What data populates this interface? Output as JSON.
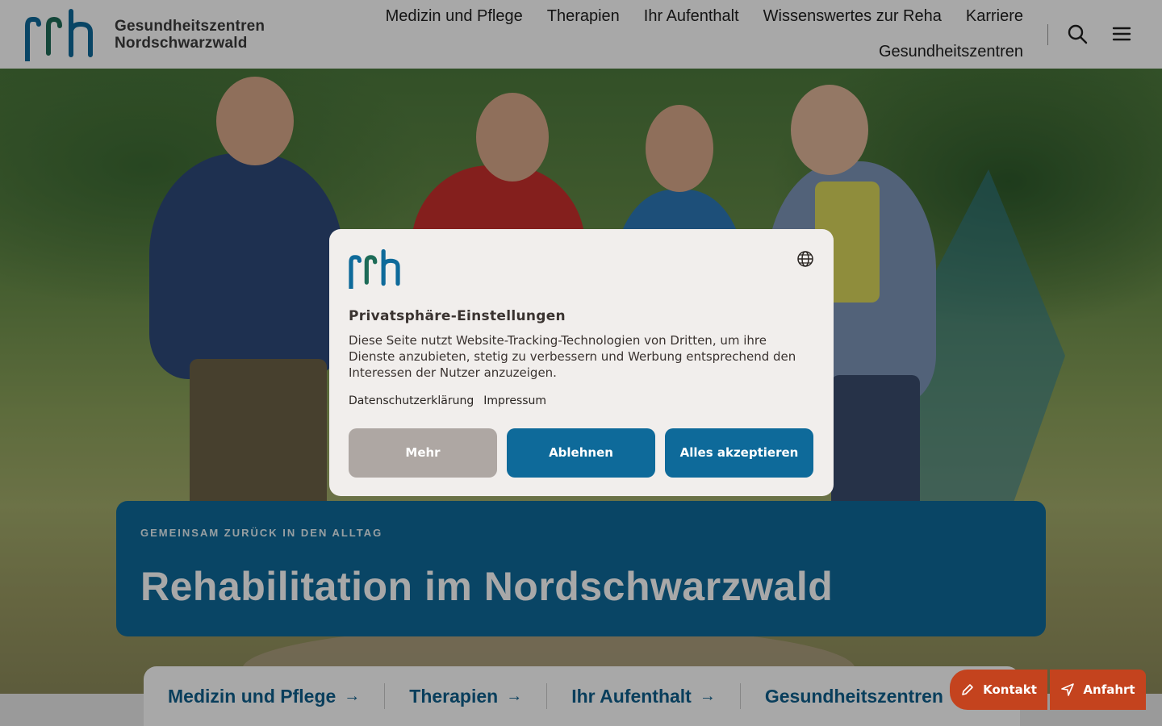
{
  "header": {
    "logo_letters": "srh",
    "logo_line1": "Gesundheitszentren",
    "logo_line2": "Nordschwarzwald",
    "nav": [
      "Medizin und Pflege",
      "Therapien",
      "Ihr Aufenthalt",
      "Wissenswertes zur Reha",
      "Karriere",
      "Gesundheitszentren"
    ],
    "icons": [
      "search-icon",
      "menu-icon"
    ]
  },
  "hero": {
    "eyebrow": "GEMEINSAM ZURÜCK IN DEN ALLTAG",
    "title": "Rehabilitation im Nordschwarzwald"
  },
  "quicknav": [
    {
      "label": "Medizin und Pflege",
      "arrow": "→"
    },
    {
      "label": "Therapien",
      "arrow": "→"
    },
    {
      "label": "Ihr Aufenthalt",
      "arrow": "→"
    },
    {
      "label": "Gesundheitszentren",
      "arrow": "→"
    }
  ],
  "floating": {
    "contact": "Kontakt",
    "directions": "Anfahrt"
  },
  "consent": {
    "logo_letters": "srh",
    "title": "Privatsphäre-Einstellungen",
    "text": "Diese Seite nutzt Website-Tracking-Technologien von Dritten, um ihre Dienste anzubieten, stetig zu verbessern und Werbung entsprechend den Interessen der Nutzer anzuzeigen.",
    "link_privacy": "Datenschutzerklärung",
    "link_imprint": "Impressum",
    "btn_more": "Mehr",
    "btn_decline": "Ablehnen",
    "btn_accept": "Alles akzeptieren"
  },
  "colors": {
    "brand_blue": "#0e6a9a",
    "accent_orange": "#c4431e",
    "modal_bg": "#f1eeec"
  }
}
